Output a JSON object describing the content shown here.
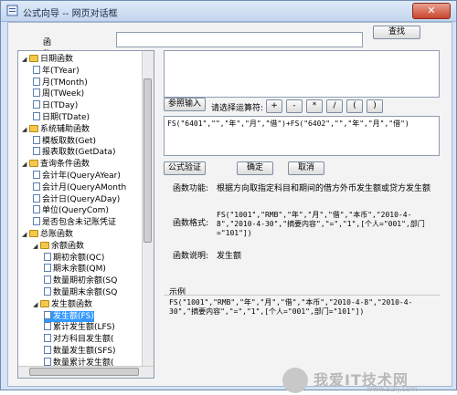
{
  "window": {
    "title": "公式向导 -- 网页对话框",
    "close_label": "✕"
  },
  "search": {
    "label": "函数名称或代码:",
    "value": "",
    "button": "查找"
  },
  "tree": {
    "items": [
      {
        "label": "日期函数",
        "type": "folder",
        "level": 0
      },
      {
        "label": "年(TYear)",
        "type": "doc",
        "level": 1
      },
      {
        "label": "月(TMonth)",
        "type": "doc",
        "level": 1
      },
      {
        "label": "周(TWeek)",
        "type": "doc",
        "level": 1
      },
      {
        "label": "日(TDay)",
        "type": "doc",
        "level": 1
      },
      {
        "label": "日期(TDate)",
        "type": "doc",
        "level": 1
      },
      {
        "label": "系统辅助函数",
        "type": "folder",
        "level": 0
      },
      {
        "label": "模板取数(Get)",
        "type": "doc",
        "level": 1
      },
      {
        "label": "报表取数(GetData)",
        "type": "doc",
        "level": 1
      },
      {
        "label": "查询条件函数",
        "type": "folder",
        "level": 0
      },
      {
        "label": "会计年(QueryAYear)",
        "type": "doc",
        "level": 1
      },
      {
        "label": "会计月(QueryAMonth",
        "type": "doc",
        "level": 1
      },
      {
        "label": "会计日(QueryADay)",
        "type": "doc",
        "level": 1
      },
      {
        "label": "单位(QueryCom)",
        "type": "doc",
        "level": 1
      },
      {
        "label": "是否包含未记账凭证",
        "type": "doc",
        "level": 1
      },
      {
        "label": "总账函数",
        "type": "folder",
        "level": 0
      },
      {
        "label": "余额函数",
        "type": "folder",
        "level": 1
      },
      {
        "label": "期初余额(QC)",
        "type": "doc",
        "level": 2
      },
      {
        "label": "期末余额(QM)",
        "type": "doc",
        "level": 2
      },
      {
        "label": "数量期初余额(SQ",
        "type": "doc",
        "level": 2
      },
      {
        "label": "数量期末余额(SQ",
        "type": "doc",
        "level": 2
      },
      {
        "label": "发生额函数",
        "type": "folder",
        "level": 1
      },
      {
        "label": "发生额(FS)",
        "type": "doc",
        "level": 2,
        "selected": true
      },
      {
        "label": "累计发生额(LFS)",
        "type": "doc",
        "level": 2
      },
      {
        "label": "对方科目发生额(",
        "type": "doc",
        "level": 2
      },
      {
        "label": "数量发生额(SFS)",
        "type": "doc",
        "level": 2
      },
      {
        "label": "数量累计发生额(",
        "type": "doc",
        "level": 2
      }
    ]
  },
  "params_button": "参照输入",
  "operators": {
    "label": "请选择运算符:",
    "items": [
      "+",
      "-",
      "*",
      "/",
      "(",
      ")"
    ]
  },
  "formula": "FS(\"6401\",\"\",\"年\",\"月\",\"借\")+FS(\"6402\",\"\",\"年\",\"月\",\"借\")",
  "actions": {
    "validate": "公式验证",
    "ok": "确定",
    "cancel": "取消"
  },
  "details": {
    "function_label": "函数功能:",
    "function_text": "根据方向取指定科目和期间的借方外币发生额或贷方发生额",
    "format_label": "函数格式:",
    "format_text": "FS(\"1001\",\"RMB\",\"年\",\"月\",\"借\",\"本币\",\"2010-4-8\",\"2010-4-30\",\"摘要内容\",\"=\",\"1\",[个人=\"001\",部门=\"101\"])",
    "desc_label": "函数说明:",
    "desc_text": "发生额",
    "example_label": "示例",
    "example_text": "FS(\"1001\",\"RMB\",\"年\",\"月\",\"借\",\"本币\",\"2010-4-8\",\"2010-4-30\",\"摘要内容\",\"=\",\"1\",[个人=\"001\",部门=\"101\"])"
  },
  "watermark": {
    "title": "我爱IT技术网",
    "url": "www.52ij.com"
  }
}
